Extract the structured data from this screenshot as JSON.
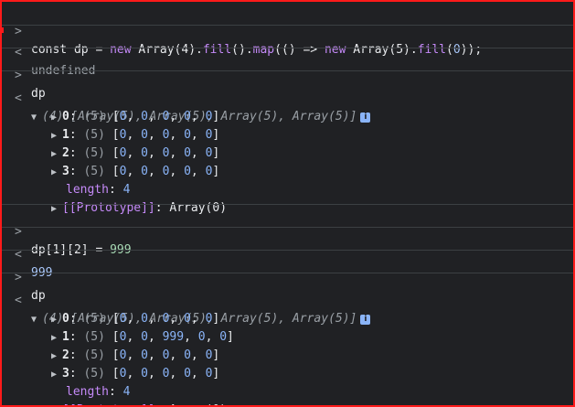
{
  "console": {
    "cmd1": {
      "prefix": "const dp = ",
      "kw_new1": "new",
      "mid1": " Array(4).",
      "fill1": "fill",
      "mid2": "().",
      "map": "map",
      "mid3": "(() => ",
      "kw_new2": "new",
      "mid4": " Array(5).",
      "fill2": "fill",
      "mid5": "(",
      "zero": "0",
      "end": "));"
    },
    "result1": "undefined",
    "cmd2": "dp",
    "array_summary": "(4) [Array(5), Array(5), Array(5), Array(5)]",
    "rows_block1": [
      {
        "key": "0",
        "len": "(5)",
        "values": [
          "0",
          "0",
          "0",
          "0",
          "0"
        ]
      },
      {
        "key": "1",
        "len": "(5)",
        "values": [
          "0",
          "0",
          "0",
          "0",
          "0"
        ]
      },
      {
        "key": "2",
        "len": "(5)",
        "values": [
          "0",
          "0",
          "0",
          "0",
          "0"
        ]
      },
      {
        "key": "3",
        "len": "(5)",
        "values": [
          "0",
          "0",
          "0",
          "0",
          "0"
        ]
      }
    ],
    "length_label": "length",
    "length_value": "4",
    "prototype_label": "[[Prototype]]",
    "prototype_value": "Array(0)",
    "cmd3_prefix": "dp[1][2] = ",
    "cmd3_value": "999",
    "result3": "999",
    "cmd4": "dp",
    "rows_block2": [
      {
        "key": "0",
        "len": "(5)",
        "values": [
          "0",
          "0",
          "0",
          "0",
          "0"
        ]
      },
      {
        "key": "1",
        "len": "(5)",
        "values": [
          "0",
          "0",
          "999",
          "0",
          "0"
        ]
      },
      {
        "key": "2",
        "len": "(5)",
        "values": [
          "0",
          "0",
          "0",
          "0",
          "0"
        ]
      },
      {
        "key": "3",
        "len": "(5)",
        "values": [
          "0",
          "0",
          "0",
          "0",
          "0"
        ]
      }
    ]
  },
  "icons": {
    "input_prompt": ">",
    "output_prompt": "<",
    "expand": "▼",
    "collapse": "▶",
    "info": "i"
  },
  "colors": {
    "background": "#202124",
    "border": "#ff1a1a",
    "keyword": "#c58af9",
    "number": "#a8c7fa"
  }
}
